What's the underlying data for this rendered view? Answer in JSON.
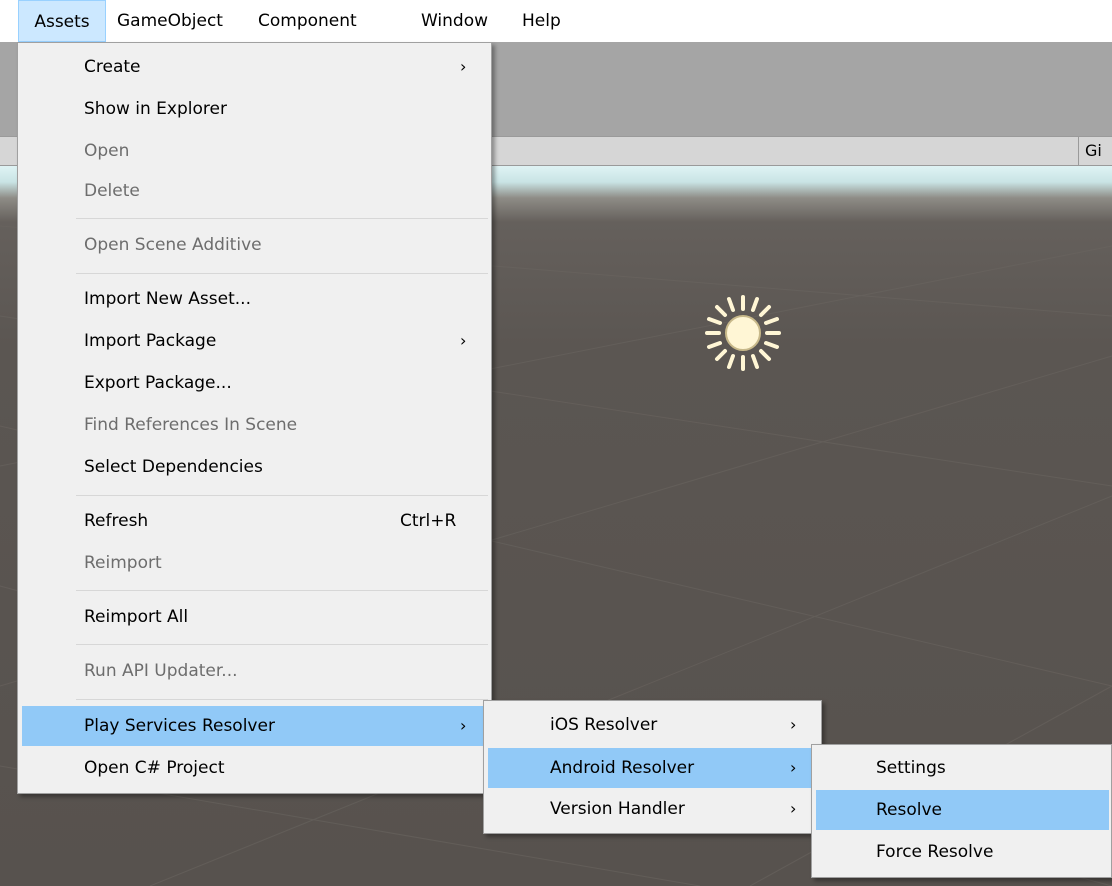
{
  "menubar": {
    "items": [
      "Assets",
      "GameObject",
      "Component",
      "Window",
      "Help"
    ]
  },
  "scene": {
    "gizmos_label": "Gi"
  },
  "assets_menu": {
    "items": [
      {
        "label": "Create",
        "submenu": true
      },
      {
        "label": "Show in Explorer"
      },
      {
        "label": "Open",
        "disabled": true
      },
      {
        "label": "Delete",
        "disabled": true
      },
      {
        "label": "Open Scene Additive",
        "disabled": true
      },
      {
        "label": "Import New Asset..."
      },
      {
        "label": "Import Package",
        "submenu": true
      },
      {
        "label": "Export Package..."
      },
      {
        "label": "Find References In Scene",
        "disabled": true
      },
      {
        "label": "Select Dependencies"
      },
      {
        "label": "Refresh",
        "shortcut": "Ctrl+R"
      },
      {
        "label": "Reimport",
        "disabled": true
      },
      {
        "label": "Reimport All"
      },
      {
        "label": "Run API Updater...",
        "disabled": true
      },
      {
        "label": "Play Services Resolver",
        "submenu": true,
        "selected": true
      },
      {
        "label": "Open C# Project"
      }
    ],
    "arrow_glyph": "›"
  },
  "resolver_menu": {
    "items": [
      {
        "label": "iOS Resolver",
        "submenu": true
      },
      {
        "label": "Android Resolver",
        "submenu": true,
        "selected": true
      },
      {
        "label": "Version Handler",
        "submenu": true
      }
    ]
  },
  "android_menu": {
    "items": [
      {
        "label": "Settings"
      },
      {
        "label": "Resolve",
        "selected": true
      },
      {
        "label": "Force Resolve"
      }
    ]
  },
  "icons": {
    "sun": "directional-light-sun-icon"
  },
  "colors": {
    "menu_background": "#f0f0f0",
    "menu_selection": "#91c9f7",
    "menubar_active": "#cce8ff",
    "disabled_text": "#6d6d6d",
    "scene_floor": "#5b5652",
    "sun": "#fff6d5"
  }
}
